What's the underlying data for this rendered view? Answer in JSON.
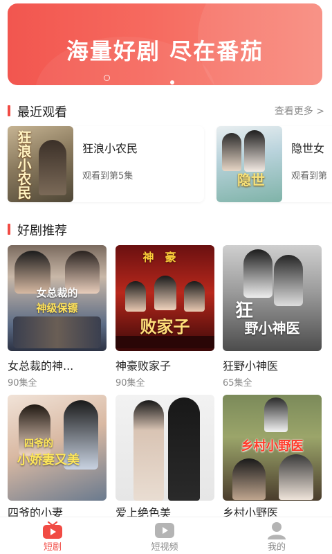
{
  "banner": {
    "text": "海量好剧 尽在番茄"
  },
  "recent": {
    "title": "最近观看",
    "more": "查看更多 >",
    "items": [
      {
        "title": "狂浪小农民",
        "progress": "观看到第5集",
        "poster_text": "狂浪小农民"
      },
      {
        "title": "隐世女",
        "progress": "观看到第",
        "poster_text": "隐世"
      }
    ]
  },
  "recommend": {
    "title": "好剧推荐",
    "items": [
      {
        "title": "女总裁的神...",
        "count": "90集全",
        "poster_lines": [
          "女总裁的",
          "神级保镖"
        ]
      },
      {
        "title": "神豪败家子",
        "count": "90集全",
        "poster_lines": [
          "神豪",
          "败家子"
        ]
      },
      {
        "title": "狂野小神医",
        "count": "65集全",
        "poster_lines": [
          "狂",
          "野小神医"
        ]
      },
      {
        "title": "四爷的小妻",
        "count": "",
        "poster_lines": [
          "四爷的",
          "小娇妻又美"
        ]
      },
      {
        "title": "爱上绝色美",
        "count": "",
        "poster_lines": []
      },
      {
        "title": "乡村小野医",
        "count": "",
        "poster_lines": [
          "乡村小野医"
        ]
      }
    ]
  },
  "tabbar": {
    "items": [
      {
        "label": "短剧",
        "icon": "tv-icon",
        "active": true
      },
      {
        "label": "短视频",
        "icon": "play-icon",
        "active": false
      },
      {
        "label": "我的",
        "icon": "user-icon",
        "active": false
      }
    ]
  },
  "colors": {
    "accent": "#f14b44",
    "inactive": "#b4b4b4"
  }
}
